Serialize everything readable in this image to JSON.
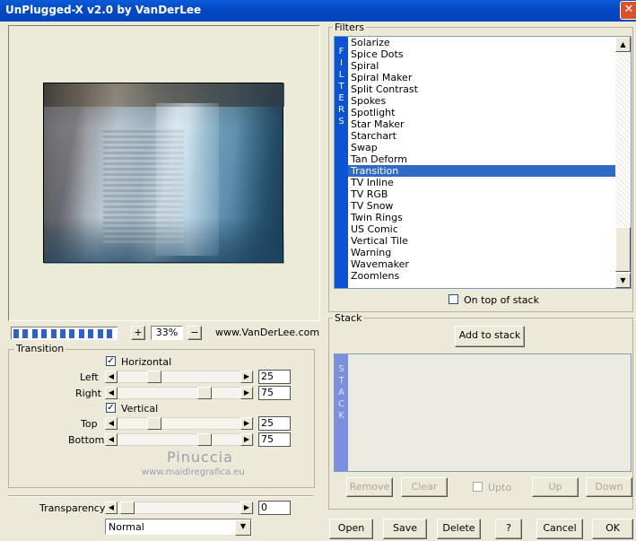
{
  "window": {
    "title": "UnPlugged-X v2.0 by VanDerLee",
    "close_glyph": "✕"
  },
  "preview": {
    "zoom": "33%",
    "zoom_plus": "+",
    "zoom_minus": "−",
    "website": "www.VanDerLee.com",
    "progress_segments": 11
  },
  "transition": {
    "group_label": "Transition",
    "horizontal_label": "Horizontal",
    "horizontal_checked": true,
    "left_label": "Left",
    "left_value": "25",
    "right_label": "Right",
    "right_value": "75",
    "vertical_label": "Vertical",
    "vertical_checked": true,
    "top_label": "Top",
    "top_value": "25",
    "bottom_label": "Bottom",
    "bottom_value": "75",
    "check_glyph": "✓",
    "arrow_left": "◀",
    "arrow_right": "▶"
  },
  "watermark": {
    "name": "Pinuccia",
    "url": "www.maidiregrafica.eu"
  },
  "transparency": {
    "label": "Transparency",
    "value": "0",
    "blend_mode": "Normal",
    "dropdown_arrow": "▼"
  },
  "filters": {
    "group_label": "Filters",
    "strip_letters": "F I L T E R S",
    "items": [
      "Solarize",
      "Spice Dots",
      "Spiral",
      "Spiral Maker",
      "Split Contrast",
      "Spokes",
      "Spotlight",
      "Star Maker",
      "Starchart",
      "Swap",
      "Tan Deform",
      "Transition",
      "TV Inline",
      "TV RGB",
      "TV Snow",
      "Twin Rings",
      "US Comic",
      "Vertical Tile",
      "Warning",
      "Wavemaker",
      "Zoomlens"
    ],
    "selected": "Transition",
    "on_top_label": "On top of stack",
    "scroll_up": "▲",
    "scroll_down": "▼"
  },
  "stack": {
    "group_label": "Stack",
    "add_button": "Add to stack",
    "strip_letters": "S T A C K",
    "remove": "Remove",
    "clear": "Clear",
    "upto": "Upto",
    "up": "Up",
    "down": "Down"
  },
  "footer": {
    "open": "Open",
    "save": "Save",
    "delete": "Delete",
    "help": "?",
    "cancel": "Cancel",
    "ok": "OK"
  },
  "colors": {
    "titlebar": "#0349c6",
    "selection": "#316ac5",
    "filters_strip": "#0a52d6",
    "stack_strip": "#7d8ee0",
    "face": "#ece9d8"
  }
}
